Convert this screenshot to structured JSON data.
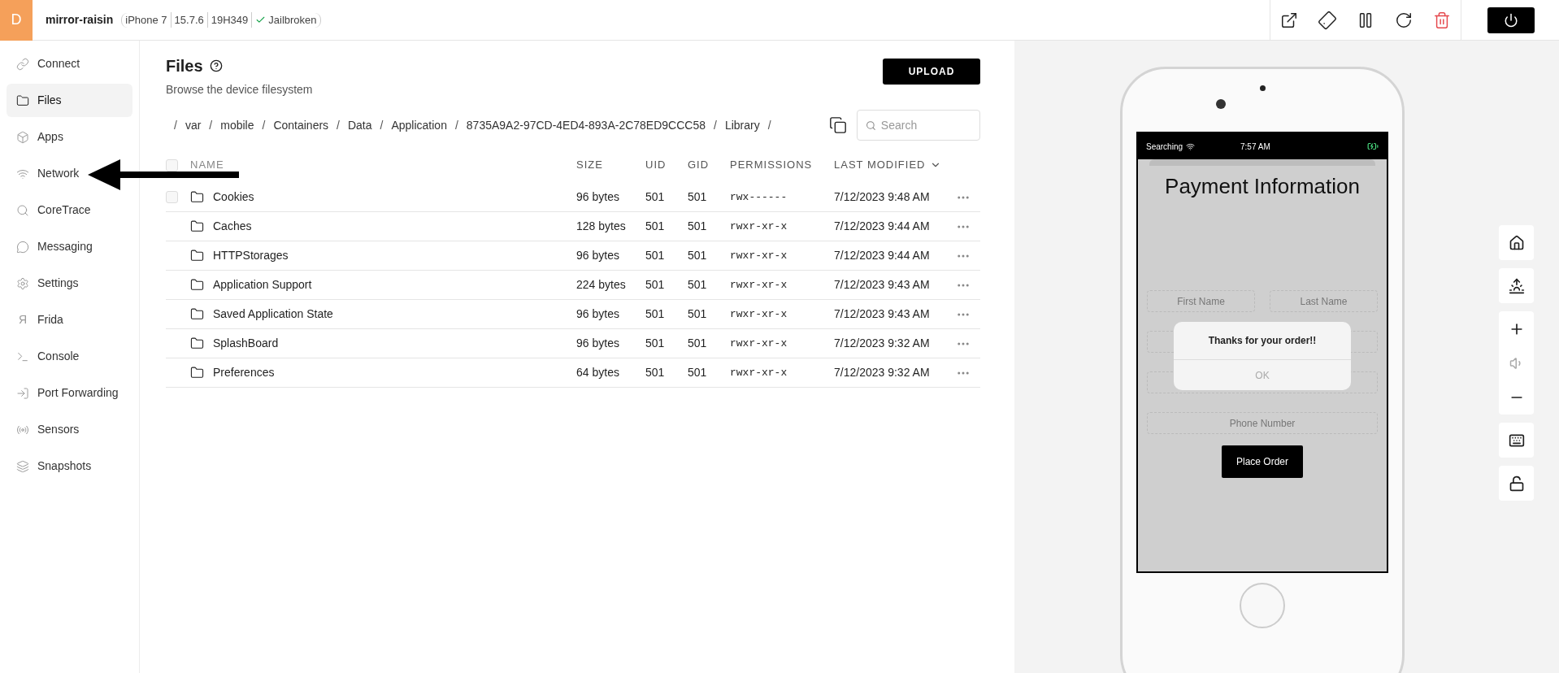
{
  "header": {
    "avatar": "D",
    "device_name": "mirror-raisin",
    "model": "iPhone 7",
    "ios_version": "15.7.6",
    "build": "19H349",
    "status": "Jailbroken"
  },
  "sidebar": {
    "items": [
      {
        "label": "Connect",
        "selected": false
      },
      {
        "label": "Files",
        "selected": true
      },
      {
        "label": "Apps",
        "selected": false
      },
      {
        "label": "Network",
        "selected": false
      },
      {
        "label": "CoreTrace",
        "selected": false
      },
      {
        "label": "Messaging",
        "selected": false
      },
      {
        "label": "Settings",
        "selected": false
      },
      {
        "label": "Frida",
        "selected": false,
        "glyph": "Я"
      },
      {
        "label": "Console",
        "selected": false
      },
      {
        "label": "Port Forwarding",
        "selected": false
      },
      {
        "label": "Sensors",
        "selected": false
      },
      {
        "label": "Snapshots",
        "selected": false
      }
    ]
  },
  "files": {
    "title": "Files",
    "subtitle": "Browse the device filesystem",
    "upload": "UPLOAD",
    "breadcrumb": [
      {
        "separator": "/",
        "label": "var"
      },
      {
        "separator": "/",
        "label": "mobile"
      },
      {
        "separator": "/",
        "label": "Containers"
      },
      {
        "separator": "/",
        "label": "Data"
      },
      {
        "separator": "/",
        "label": "Application"
      },
      {
        "separator": "/",
        "label": "8735A9A2-97CD-4ED4-893A-2C78ED9CCC58"
      },
      {
        "separator": "/",
        "label": "Library"
      }
    ],
    "breadcrumb_end": "/",
    "select_all_checked": false,
    "search": {
      "placeholder": "Search"
    },
    "table": {
      "columns": [
        "NAME",
        "SIZE",
        "UID",
        "GID",
        "PERMISSIONS",
        "LAST MODIFIED"
      ],
      "rows": [
        {
          "name": "Cookies",
          "size": "96 bytes",
          "uid": "501",
          "gid": "501",
          "permissions": "rwx------",
          "modified": "7/12/2023 9:48 AM",
          "hovered": true,
          "checked": false
        },
        {
          "name": "Caches",
          "size": "128 bytes",
          "uid": "501",
          "gid": "501",
          "permissions": "rwxr-xr-x",
          "modified": "7/12/2023 9:44 AM",
          "hovered": false,
          "checked": false
        },
        {
          "name": "HTTPStorages",
          "size": "96 bytes",
          "uid": "501",
          "gid": "501",
          "permissions": "rwxr-xr-x",
          "modified": "7/12/2023 9:44 AM",
          "hovered": false,
          "checked": false
        },
        {
          "name": "Application Support",
          "size": "224 bytes",
          "uid": "501",
          "gid": "501",
          "permissions": "rwxr-xr-x",
          "modified": "7/12/2023 9:43 AM",
          "hovered": false,
          "checked": false
        },
        {
          "name": "Saved Application State",
          "size": "96 bytes",
          "uid": "501",
          "gid": "501",
          "permissions": "rwxr-xr-x",
          "modified": "7/12/2023 9:43 AM",
          "hovered": false,
          "checked": false
        },
        {
          "name": "SplashBoard",
          "size": "96 bytes",
          "uid": "501",
          "gid": "501",
          "permissions": "rwxr-xr-x",
          "modified": "7/12/2023 9:32 AM",
          "hovered": false,
          "checked": false
        },
        {
          "name": "Preferences",
          "size": "64 bytes",
          "uid": "501",
          "gid": "501",
          "permissions": "rwxr-xr-x",
          "modified": "7/12/2023 9:32 AM",
          "hovered": false,
          "checked": false
        }
      ]
    }
  },
  "phone": {
    "carrier": "Searching",
    "time": "7:57 AM",
    "title": "Payment Information",
    "first_name": "First Name",
    "last_name": "Last Name",
    "phone_number": "Phone Number",
    "place_order": "Place Order",
    "alert": {
      "message": "Thanks for your order!!",
      "button": "OK"
    }
  }
}
